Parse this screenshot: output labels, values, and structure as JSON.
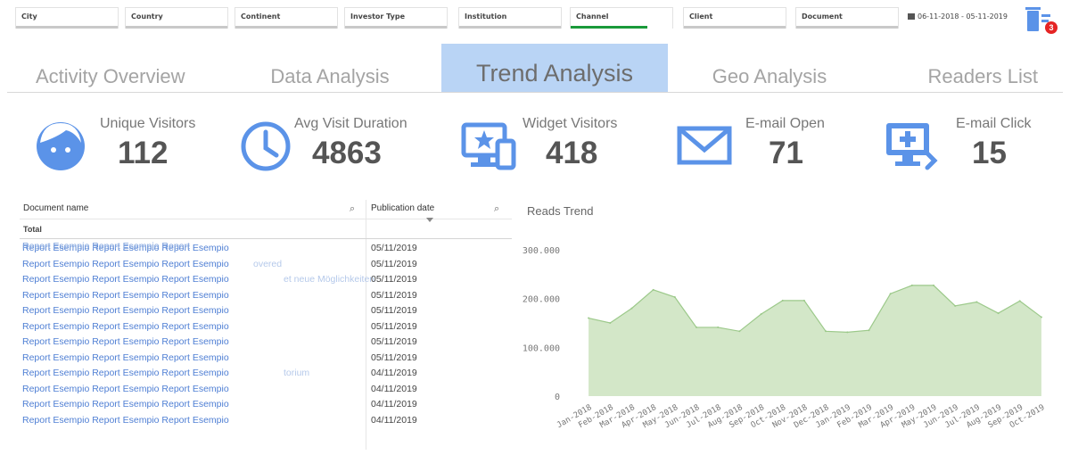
{
  "filters": [
    {
      "label": "City",
      "bar": "grey"
    },
    {
      "label": "Country",
      "bar": "grey"
    },
    {
      "label": "Continent",
      "bar": "grey"
    },
    {
      "label": "Investor Type",
      "bar": "grey"
    },
    {
      "label": "Institution",
      "bar": "grey"
    },
    {
      "label": "Channel",
      "bar": "green"
    },
    {
      "label": "Client",
      "bar": "grey"
    },
    {
      "label": "Document",
      "bar": "grey"
    }
  ],
  "date_range": "06-11-2018 - 05-11-2019",
  "trash_badge": "3",
  "tabs": [
    {
      "label": "Activity Overview",
      "active": false
    },
    {
      "label": "Data Analysis",
      "active": false
    },
    {
      "label": "Trend Analysis",
      "active": true
    },
    {
      "label": "Geo Analysis",
      "active": false
    },
    {
      "label": "Readers List",
      "active": false
    }
  ],
  "kpis": [
    {
      "label": "Unique Visitors",
      "value": "112",
      "icon": "face-icon"
    },
    {
      "label": "Avg Visit Duration",
      "value": "4863",
      "icon": "clock-icon"
    },
    {
      "label": "Widget Visitors",
      "value": "418",
      "icon": "monitor-star-icon"
    },
    {
      "label": "E-mail Open",
      "value": "71",
      "icon": "envelope-icon"
    },
    {
      "label": "E-mail Click",
      "value": "15",
      "icon": "monitor-plus-icon"
    }
  ],
  "accent_color": "#5b93e8",
  "table": {
    "col_document": "Document name",
    "col_date": "Publication date",
    "total_label": "Total",
    "first_row_overlap": "Report Esempio Report Esempio Report",
    "rows": [
      {
        "doc": "Report Esempio Report Esempio Report Esempio",
        "ghost": "",
        "date": "05/11/2019"
      },
      {
        "doc": "Report Esempio Report Esempio Report Esempio",
        "ghost": "overed",
        "date": "05/11/2019"
      },
      {
        "doc": "Report Esempio Report Esempio Report Esempio",
        "ghost": "et neue Möglichkeiten",
        "date": "05/11/2019"
      },
      {
        "doc": "Report Esempio Report Esempio Report Esempio",
        "ghost": "",
        "date": "05/11/2019"
      },
      {
        "doc": "Report Esempio Report Esempio Report Esempio",
        "ghost": "",
        "date": "05/11/2019"
      },
      {
        "doc": "Report Esempio Report Esempio Report Esempio",
        "ghost": "",
        "date": "05/11/2019"
      },
      {
        "doc": "Report Esempio Report Esempio Report Esempio",
        "ghost": "",
        "date": "05/11/2019"
      },
      {
        "doc": "Report Esempio Report Esempio Report Esempio",
        "ghost": "",
        "date": "05/11/2019"
      },
      {
        "doc": "Report Esempio Report Esempio Report Esempio",
        "ghost": "torium",
        "date": "04/11/2019"
      },
      {
        "doc": "Report Esempio Report Esempio Report Esempio",
        "ghost": "",
        "date": "04/11/2019"
      },
      {
        "doc": "Report Esempio Report Esempio Report Esempio",
        "ghost": "",
        "date": "04/11/2019"
      },
      {
        "doc": "Report Esempio Report Esempio Report Esempio",
        "ghost": "",
        "date": "04/11/2019"
      }
    ]
  },
  "chart_data": {
    "type": "area",
    "title": "Reads Trend",
    "xlabel": "",
    "ylabel": "",
    "categories": [
      "Jan-2018",
      "Feb-2018",
      "Mar-2018",
      "Apr-2018",
      "May-2018",
      "Jun-2018",
      "Jul-2018",
      "Aug-2018",
      "Sep-2018",
      "Oct-2018",
      "Nov-2018",
      "Dec-2018",
      "Jan-2019",
      "Feb-2019",
      "Mar-2019",
      "Apr-2019",
      "May-2019",
      "Jun-2019",
      "Jul-2019",
      "Aug-2019",
      "Sep-2019",
      "Oct-2019"
    ],
    "values": [
      160000,
      150000,
      180000,
      218000,
      203000,
      141000,
      141000,
      133000,
      168000,
      196000,
      196000,
      133000,
      131000,
      135000,
      210000,
      227000,
      227000,
      185000,
      193000,
      170000,
      195000,
      162000
    ],
    "ylim": [
      0,
      300000
    ],
    "yticks": [
      0,
      100000,
      200000,
      300000
    ],
    "ytick_labels": [
      "0",
      "100.000",
      "200.000",
      "300.000"
    ],
    "grid": false,
    "fill_color": "#d3e7c8",
    "line_color": "#9cc98a"
  }
}
